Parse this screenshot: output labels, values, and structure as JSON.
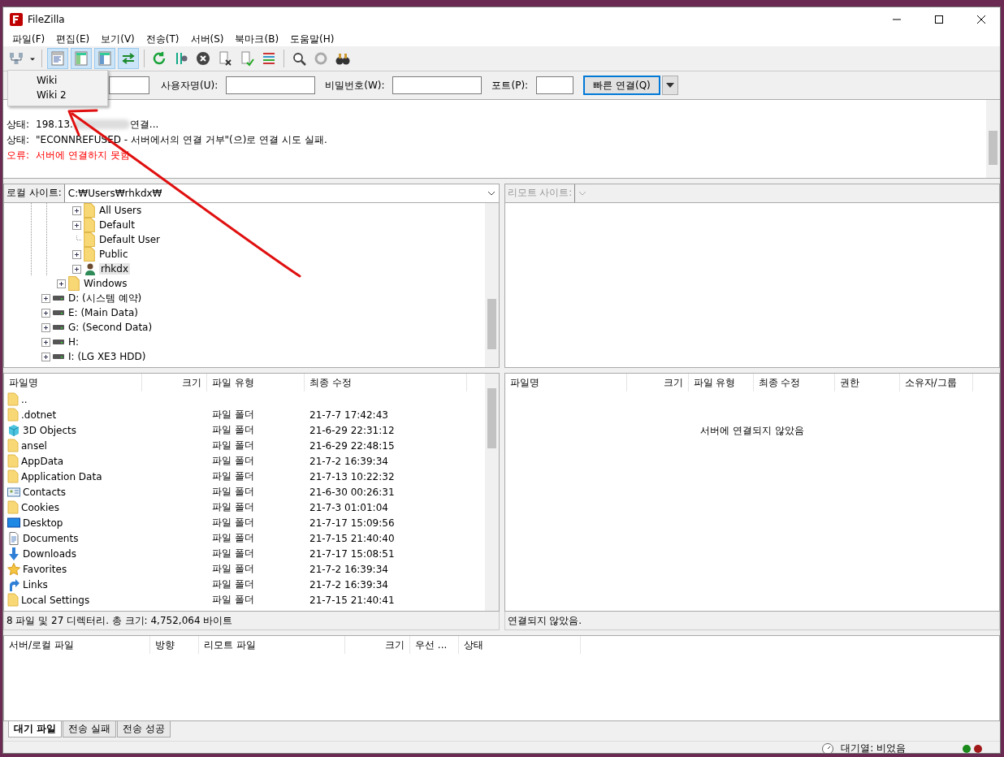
{
  "window": {
    "title": "FileZilla"
  },
  "menu": [
    "파일(F)",
    "편집(E)",
    "보기(V)",
    "전송(T)",
    "서버(S)",
    "북마크(B)",
    "도움말(H)"
  ],
  "view_toggles": [
    {
      "on": true
    },
    {
      "on": true
    },
    {
      "on": true
    },
    {
      "on": true
    }
  ],
  "site_menu": [
    "Wiki",
    "Wiki 2"
  ],
  "quickconnect": {
    "fields": [
      {
        "label": "사용자명(U):"
      },
      {
        "label": "비밀번호(W):"
      },
      {
        "label": "포트(P):"
      }
    ],
    "button": "빠른 연결(Q)"
  },
  "log": [
    {
      "kind": "status",
      "label": "상태:",
      "parts": [
        "198.13.",
        "연결..."
      ]
    },
    {
      "kind": "status",
      "label": "상태:",
      "parts": [
        "\"ECONNREFUSED - 서버에서의 연결 거부\"(으)로 연결 시도 실패."
      ]
    },
    {
      "kind": "error",
      "label": "오류:",
      "parts": [
        "서버에 연결하지 못함"
      ]
    }
  ],
  "local_site": {
    "label": "로컬 사이트:",
    "path": "C:₩Users₩rhkdx₩"
  },
  "remote_site": {
    "label": "리모트 사이트:",
    "disabled": true
  },
  "tree": [
    {
      "expandable": true,
      "children": [
        {
          "expandable": true,
          "children": [
            {
              "label": "All Users",
              "kind": "folder",
              "expandable": true,
              "selected": false
            },
            {
              "label": "Default",
              "kind": "folder",
              "expandable": true,
              "selected": false
            },
            {
              "label": "Default User",
              "kind": "folder",
              "expandable": false,
              "selected": false
            },
            {
              "label": "Public",
              "kind": "folder",
              "expandable": true,
              "selected": false
            },
            {
              "label": "rhkdx",
              "kind": "user",
              "expandable": true,
              "selected": true
            }
          ]
        },
        {
          "label": "Windows",
          "kind": "folder",
          "expandable": true,
          "selected": false
        }
      ]
    },
    {
      "label": "D: (시스템 예약)",
      "kind": "drive",
      "expandable": true,
      "selected": false
    },
    {
      "label": "E: (Main Data)",
      "kind": "drive",
      "expandable": true,
      "selected": false
    },
    {
      "label": "G: (Second Data)",
      "kind": "drive",
      "expandable": true,
      "selected": false
    },
    {
      "label": "H:",
      "kind": "drive",
      "expandable": true,
      "selected": false
    },
    {
      "label": "I: (LG XE3 HDD)",
      "kind": "drive",
      "expandable": true,
      "selected": false
    }
  ],
  "local_files": {
    "columns": [
      "파일명",
      "크기",
      "파일 유형",
      "최종 수정"
    ],
    "rows": [
      {
        "name": "..",
        "kind": "folder"
      },
      {
        "name": ".dotnet",
        "kind": "folder",
        "type": "파일 폴더",
        "modified": "21-7-7 17:42:43"
      },
      {
        "name": "3D Objects",
        "kind": "cube",
        "type": "파일 폴더",
        "modified": "21-6-29 22:31:12"
      },
      {
        "name": "ansel",
        "kind": "folder",
        "type": "파일 폴더",
        "modified": "21-6-29 22:48:15"
      },
      {
        "name": "AppData",
        "kind": "folder",
        "type": "파일 폴더",
        "modified": "21-7-2 16:39:34"
      },
      {
        "name": "Application Data",
        "kind": "folder",
        "type": "파일 폴더",
        "modified": "21-7-13 10:22:32"
      },
      {
        "name": "Contacts",
        "kind": "contacts",
        "type": "파일 폴더",
        "modified": "21-6-30 00:26:31"
      },
      {
        "name": "Cookies",
        "kind": "folder",
        "type": "파일 폴더",
        "modified": "21-7-3 01:01:04"
      },
      {
        "name": "Desktop",
        "kind": "desktop",
        "type": "파일 폴더",
        "modified": "21-7-17 15:09:56"
      },
      {
        "name": "Documents",
        "kind": "document",
        "type": "파일 폴더",
        "modified": "21-7-15 21:40:40"
      },
      {
        "name": "Downloads",
        "kind": "download",
        "type": "파일 폴더",
        "modified": "21-7-17 15:08:51"
      },
      {
        "name": "Favorites",
        "kind": "star",
        "type": "파일 폴더",
        "modified": "21-7-2 16:39:34"
      },
      {
        "name": "Links",
        "kind": "link",
        "type": "파일 폴더",
        "modified": "21-7-2 16:39:34"
      },
      {
        "name": "Local Settings",
        "kind": "folder",
        "type": "파일 폴더",
        "modified": "21-7-15 21:40:41"
      }
    ],
    "status": "8 파일 및 27 디렉터리. 총 크기: 4,752,064 바이트"
  },
  "remote_files": {
    "columns": [
      "파일명",
      "크기",
      "파일 유형",
      "최종 수정",
      "권한",
      "소유자/그룹"
    ],
    "message": "서버에 연결되지 않았음",
    "status": "연결되지 않았음."
  },
  "queue": {
    "columns": [
      "서버/로컬 파일",
      "방향",
      "리모트 파일",
      "크기",
      "우선 ...",
      "상태"
    ]
  },
  "queue_tabs": [
    {
      "label": "대기 파일",
      "selected": true
    },
    {
      "label": "전송 실패",
      "selected": false
    },
    {
      "label": "전송 성공",
      "selected": false
    }
  ],
  "status_bar": {
    "queue": "대기열: 비었음"
  }
}
